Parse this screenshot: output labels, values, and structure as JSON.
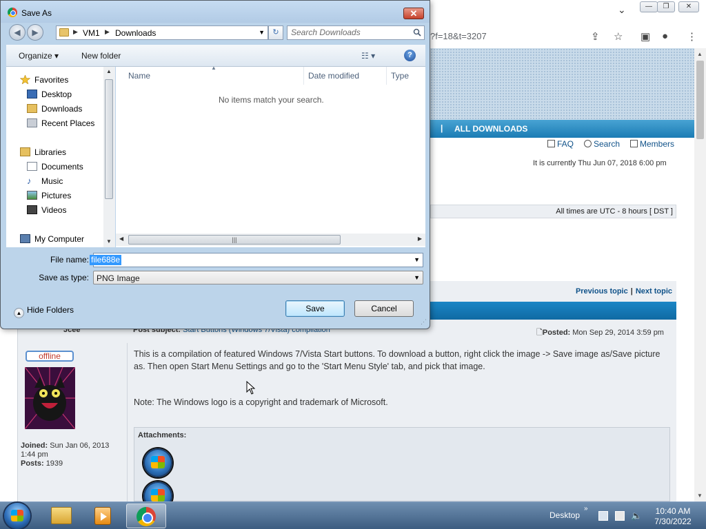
{
  "browser": {
    "url_visible": "?f=18&t=3207",
    "nav_title": "ALL DOWNLOADS",
    "nav_sep": "|",
    "nav_links": [
      "FAQ",
      "Search",
      "Members"
    ],
    "current_time": "It is currently Thu Jun 07, 2018 6:00 pm",
    "times_note": "All times are UTC - 8 hours [ DST ]",
    "previous_topic": "Previous topic",
    "next_topic": "Next topic",
    "topic_sep": "|"
  },
  "post": {
    "author": "Jcee",
    "subject_label": "Post subject:",
    "subject": "Start Buttons (Windows 7/Vista) compilation",
    "posted_label": "Posted:",
    "posted": "Mon Sep 29, 2014 3:59 pm",
    "status": "offline",
    "joined_label": "Joined:",
    "joined": "Sun Jan 06, 2013 1:44 pm",
    "posts_label": "Posts:",
    "posts": "1939",
    "body": "This is a compilation of featured Windows 7/Vista Start buttons. To download a button, right click the image -> Save image as/Save picture as. Then open Start Menu Settings and go to the 'Start Menu Style' tab, and pick that image.",
    "note": "Note: The Windows logo is a copyright and trademark of Microsoft.",
    "attachments_label": "Attachments:"
  },
  "dialog": {
    "title": "Save As",
    "close": "✕",
    "breadcrumb": [
      "VM1",
      "Downloads"
    ],
    "search_placeholder": "Search Downloads",
    "organize": "Organize ▾",
    "new_folder": "New folder",
    "help": "?",
    "nav_items": [
      {
        "label": "Favorites",
        "icon": "star-icon"
      },
      {
        "label": "Desktop",
        "icon": "desktop-icon"
      },
      {
        "label": "Downloads",
        "icon": "downloads-folder-icon"
      },
      {
        "label": "Recent Places",
        "icon": "recent-places-icon"
      },
      {
        "label": "Libraries",
        "icon": "libraries-icon"
      },
      {
        "label": "Documents",
        "icon": "documents-icon"
      },
      {
        "label": "Music",
        "icon": "music-icon"
      },
      {
        "label": "Pictures",
        "icon": "pictures-icon"
      },
      {
        "label": "Videos",
        "icon": "videos-icon"
      },
      {
        "label": "My Computer",
        "icon": "computer-icon"
      }
    ],
    "columns": [
      "Name",
      "Date modified",
      "Type"
    ],
    "empty_message": "No items match your search.",
    "file_name_label": "File name:",
    "file_name_value": "file688e",
    "save_type_label": "Save as type:",
    "save_type_value": "PNG Image",
    "hide_folders": "Hide Folders",
    "save_button": "Save",
    "cancel_button": "Cancel"
  },
  "taskbar": {
    "desktop_label": "Desktop",
    "time": "10:40 AM",
    "date": "7/30/2022"
  },
  "colors": {
    "forum_nav": "#1b7cb4",
    "link": "#105289",
    "selection": "#3399ff"
  }
}
